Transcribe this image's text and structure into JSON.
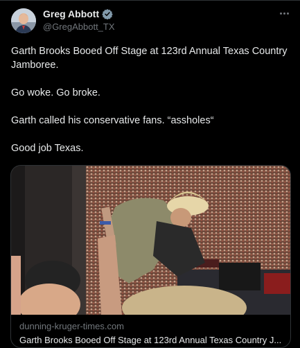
{
  "tweet": {
    "author_name": "Greg Abbott",
    "author_handle": "@GregAbbott_TX",
    "verified_badge_color": "#829aab",
    "text": "Garth Brooks Booed Off Stage at 123rd Annual Texas Country Jamboree.\n\nGo woke. Go broke.\n\nGarth called his conservative fans. “assholes“\n\nGood job Texas."
  },
  "card": {
    "domain": "dunning-kruger-times.com",
    "title": "Garth Brooks Booed Off Stage at 123rd Annual Texas Country J..."
  },
  "icons": {
    "avatar": "profile-photo",
    "verified": "verified-badge-icon",
    "more": "more-options-icon"
  },
  "colors": {
    "background": "#000000",
    "text": "#e7e9ea",
    "secondary_text": "#71767b",
    "border": "#2f3336"
  }
}
